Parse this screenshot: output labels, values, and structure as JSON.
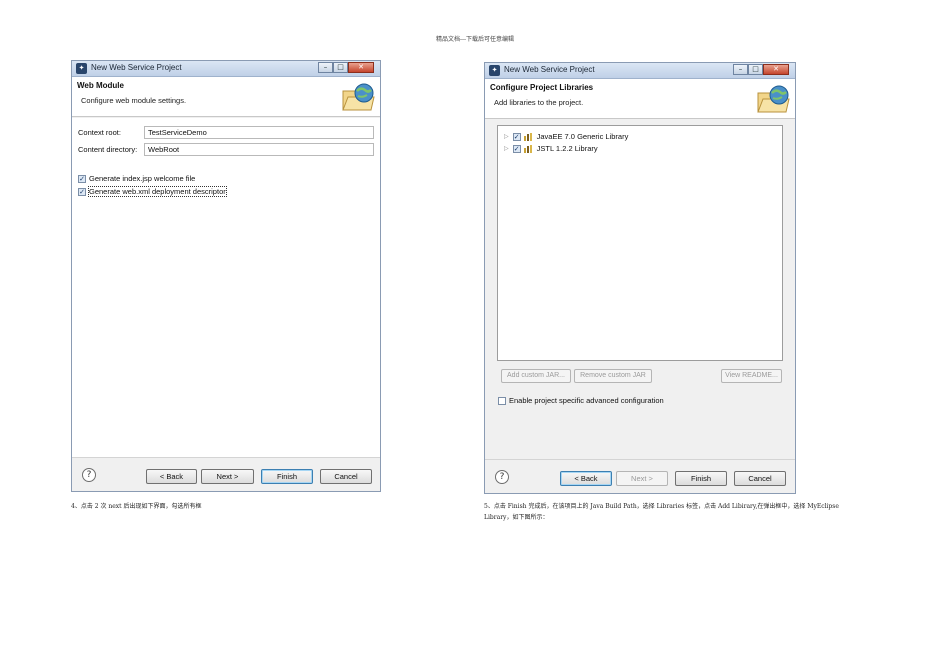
{
  "page_header": "精品文档---下载后可任意编辑",
  "left_dialog": {
    "title": "New Web Service Project",
    "banner_title": "Web Module",
    "banner_desc": "Configure web module settings.",
    "fields": [
      {
        "label": "Context root:",
        "value": "TestServiceDemo"
      },
      {
        "label": "Content directory:",
        "value": "WebRoot"
      }
    ],
    "checkboxes": [
      {
        "label": "Generate index.jsp welcome file",
        "checked": true
      },
      {
        "label": "Generate web.xml deployment descriptor",
        "checked": true
      }
    ],
    "buttons": {
      "help": "?",
      "back": "< Back",
      "next": "Next >",
      "finish": "Finish",
      "cancel": "Cancel"
    }
  },
  "right_dialog": {
    "title": "New Web Service Project",
    "banner_title": "Configure Project Libraries",
    "banner_desc": "Add libraries to the project.",
    "libraries": [
      {
        "label": "JavaEE 7.0 Generic Library",
        "checked": true
      },
      {
        "label": "JSTL 1.2.2 Library",
        "checked": true
      }
    ],
    "side_buttons": {
      "add_jar": "Add custom JAR...",
      "remove_jar": "Remove custom JAR",
      "readme": "View README..."
    },
    "advanced_checkbox": {
      "label": "Enable project specific advanced configuration",
      "checked": false
    },
    "buttons": {
      "help": "?",
      "back": "< Back",
      "next": "Next >",
      "finish": "Finish",
      "cancel": "Cancel"
    }
  },
  "captions": {
    "left": "4、点击 2 次 next 后出现如下界面，勾选所有框",
    "right_line1": "5、点击 Finish 完成后，在该项目上的 Java Build Path，选择 Libraries 标签，点击 Add Libirary,在弹出框中，选择 MyEclipse",
    "right_line2": "Library，如下图所示："
  },
  "colors": {
    "titlebar": "#bfd0e7",
    "close_button": "#c5452d",
    "focus_border": "#3c7fb1"
  }
}
